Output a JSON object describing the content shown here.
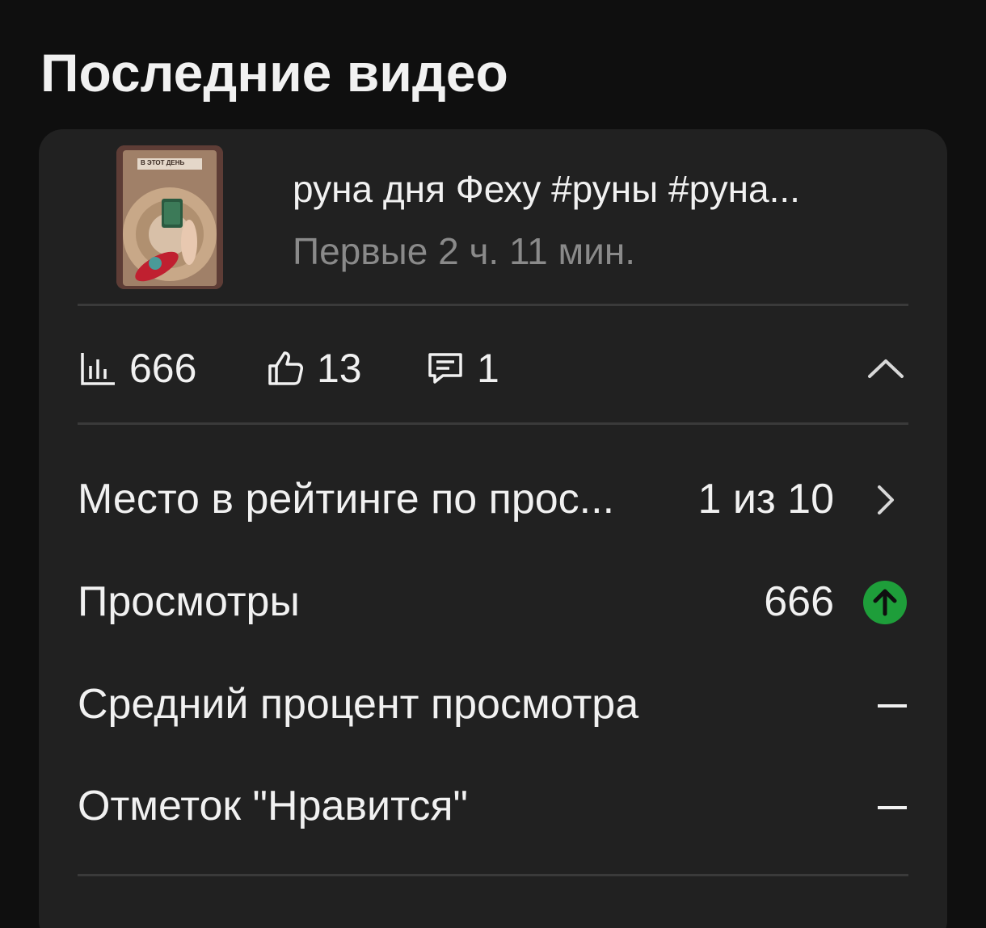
{
  "section": {
    "title": "Последние видео"
  },
  "video": {
    "title": "руна дня Феху #руны #руна...",
    "subtitle": "Первые 2 ч. 11 мин.",
    "thumbnail_caption": "В ЭТОТ ДЕНЬ"
  },
  "stats": {
    "views": "666",
    "likes": "13",
    "comments": "1"
  },
  "metrics": [
    {
      "label": "Место в рейтинге по прос...",
      "value": "1 из 10",
      "trailing": "chevron-right-icon"
    },
    {
      "label": "Просмотры",
      "value": "666",
      "trailing": "arrow-up-circle-icon"
    },
    {
      "label": "Средний процент просмотра",
      "value": "—"
    },
    {
      "label": "Отметок \"Нравится\"",
      "value": "—"
    }
  ],
  "colors": {
    "background": "#0f0f0f",
    "card": "#212121",
    "divider": "#3a3a3a",
    "secondary_text": "#8a8a8a",
    "trend_up": "#1e9e3a"
  }
}
